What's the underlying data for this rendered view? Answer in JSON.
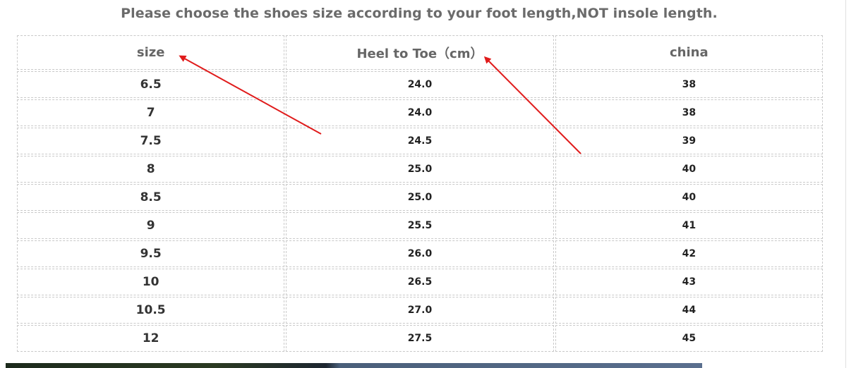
{
  "title": "Please choose the shoes size according to your foot length,NOT insole length.",
  "table": {
    "headers": [
      "size",
      "Heel to Toe（cm）",
      "china"
    ],
    "rows": [
      [
        "6.5",
        "24.0",
        "38"
      ],
      [
        "7",
        "24.0",
        "38"
      ],
      [
        "7.5",
        "24.5",
        "39"
      ],
      [
        "8",
        "25.0",
        "40"
      ],
      [
        "8.5",
        "25.0",
        "40"
      ],
      [
        "9",
        "25.5",
        "41"
      ],
      [
        "9.5",
        "26.0",
        "42"
      ],
      [
        "10",
        "26.5",
        "43"
      ],
      [
        "10.5",
        "27.0",
        "44"
      ],
      [
        "12",
        "27.5",
        "45"
      ]
    ]
  },
  "colors": {
    "arrow": "#e01b1b",
    "header_text": "#666666",
    "border": "#c9c9c9"
  }
}
